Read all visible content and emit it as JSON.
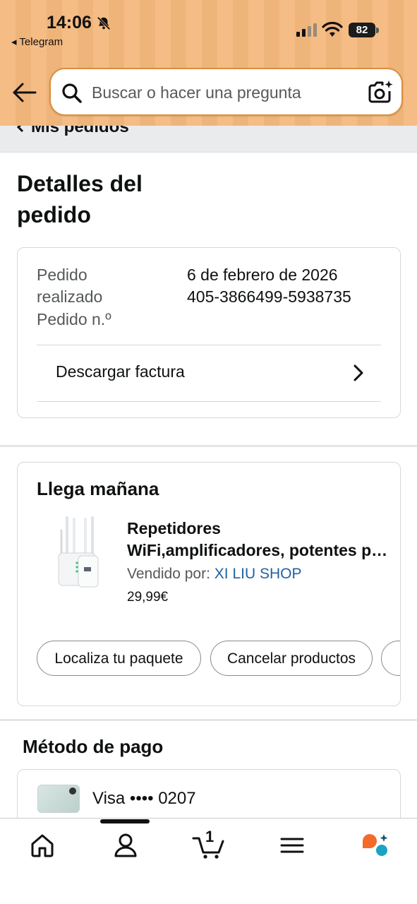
{
  "status_bar": {
    "time": "14:06",
    "back_app": "◂ Telegram",
    "battery": "82"
  },
  "search": {
    "placeholder": "Buscar o hacer una pregunta"
  },
  "breadcrumb": {
    "label": "Mis pedidos"
  },
  "page": {
    "title": "Detalles del pedido"
  },
  "order_info": {
    "placed_label_line1": "Pedido",
    "placed_label_line2": "realizado",
    "placed_value": "6 de febrero de 2026",
    "number_label": "Pedido n.º",
    "number_value": "405-3866499-5938735",
    "download_invoice": "Descargar factura"
  },
  "delivery": {
    "title": "Llega mañana",
    "product_name_line1": "Repetidores",
    "product_name_line2": "WiFi,amplificadores, potentes para red WiFi",
    "sold_by_label": "Vendido por: ",
    "seller": "XI LIU SHOP",
    "price": "29,99€",
    "actions": [
      "Localiza tu paquete",
      "Cancelar productos"
    ]
  },
  "payment": {
    "title": "Método de pago",
    "card": "Visa •••• 0207"
  },
  "tabbar": {
    "cart_count": "1",
    "items": [
      "home",
      "account",
      "cart",
      "menu",
      "rufus"
    ]
  },
  "colors": {
    "header_bg": "#f5bd85",
    "link": "#2162a1",
    "search_border": "#d88f3f"
  }
}
